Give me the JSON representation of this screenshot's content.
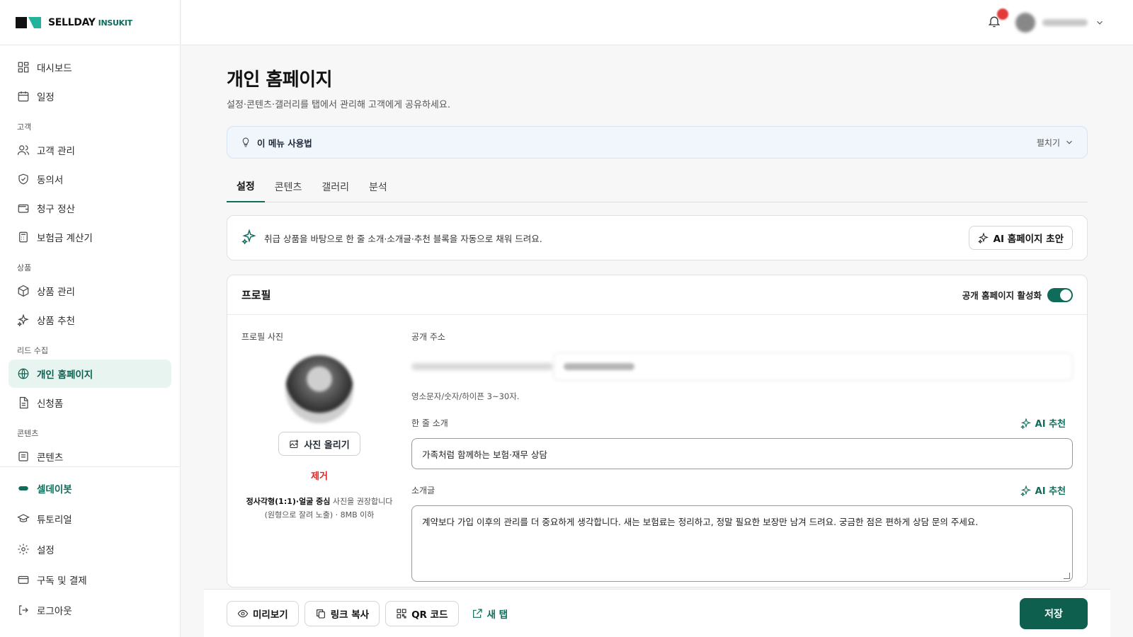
{
  "brand": {
    "name": "SELLDAY",
    "sub": "INSUKIT",
    "accent": "#0f6b5a"
  },
  "sidebar": {
    "items": [
      {
        "label": "대시보드",
        "icon": "dashboard-icon"
      },
      {
        "label": "일정",
        "icon": "calendar-icon"
      }
    ],
    "sections": [
      {
        "title": "고객",
        "items": [
          {
            "label": "고객 관리",
            "icon": "users-icon"
          },
          {
            "label": "동의서",
            "icon": "shield-check-icon"
          },
          {
            "label": "청구 정산",
            "icon": "wallet-icon"
          },
          {
            "label": "보험금 계산기",
            "icon": "calculator-icon"
          }
        ]
      },
      {
        "title": "상품",
        "items": [
          {
            "label": "상품 관리",
            "icon": "box-icon"
          },
          {
            "label": "상품 추천",
            "icon": "sparkle-icon"
          }
        ]
      },
      {
        "title": "리드 수집",
        "items": [
          {
            "label": "개인 홈페이지",
            "icon": "globe-icon",
            "active": true
          },
          {
            "label": "신청폼",
            "icon": "file-icon"
          }
        ]
      },
      {
        "title": "콘텐츠",
        "items": [
          {
            "label": "콘텐츠",
            "icon": "content-icon"
          }
        ]
      }
    ],
    "bottom": [
      {
        "label": "셀데이봇",
        "icon": "bot-icon"
      },
      {
        "label": "튜토리얼",
        "icon": "graduation-icon"
      },
      {
        "label": "설정",
        "icon": "gear-icon"
      },
      {
        "label": "구독 및 결제",
        "icon": "card-icon"
      },
      {
        "label": "로그아웃",
        "icon": "logout-icon"
      }
    ]
  },
  "page": {
    "title": "개인 홈페이지",
    "subtitle": "설정·콘텐츠·갤러리를 탭에서 관리해 고객에게 공유하세요."
  },
  "help": {
    "title": "이 메뉴 사용법",
    "toggle": "펼치기"
  },
  "tabs": [
    "설정",
    "콘텐츠",
    "갤러리",
    "분석"
  ],
  "ai_banner": {
    "text": "취급 상품을 바탕으로 한 줄 소개·소개글·추천 블록을 자동으로 채워 드려요.",
    "button": "AI 홈페이지 초안"
  },
  "profile": {
    "title": "프로필",
    "toggle_label": "공개 홈페이지 활성화",
    "photo_label": "프로필 사진",
    "upload_label": "사진 올리기",
    "remove_label": "제거",
    "hint_strong": "정사각형(1:1)·얼굴 중심",
    "hint_rest": " 사진을 권장합니다",
    "hint_line2": "(원형으로 잘려 노출) · 8MB 이하",
    "url_label": "공개 주소",
    "url_help": "영소문자/숫자/하이픈 3~30자.",
    "tagline_label": "한 줄 소개",
    "tagline_value": "가족처럼 함께하는 보험·재무 상담",
    "intro_label": "소개글",
    "intro_value": "계약보다 가입 이후의 관리를 더 중요하게 생각합니다. 새는 보험료는 정리하고, 정말 필요한 보장만 남겨 드려요. 궁금한 점은 편하게 상담 문의 주세요.",
    "ai_recommend": "AI 추천"
  },
  "actions": {
    "preview": "미리보기",
    "copy_link": "링크 복사",
    "qr": "QR 코드",
    "new_tab": "새 탭",
    "save": "저장"
  }
}
